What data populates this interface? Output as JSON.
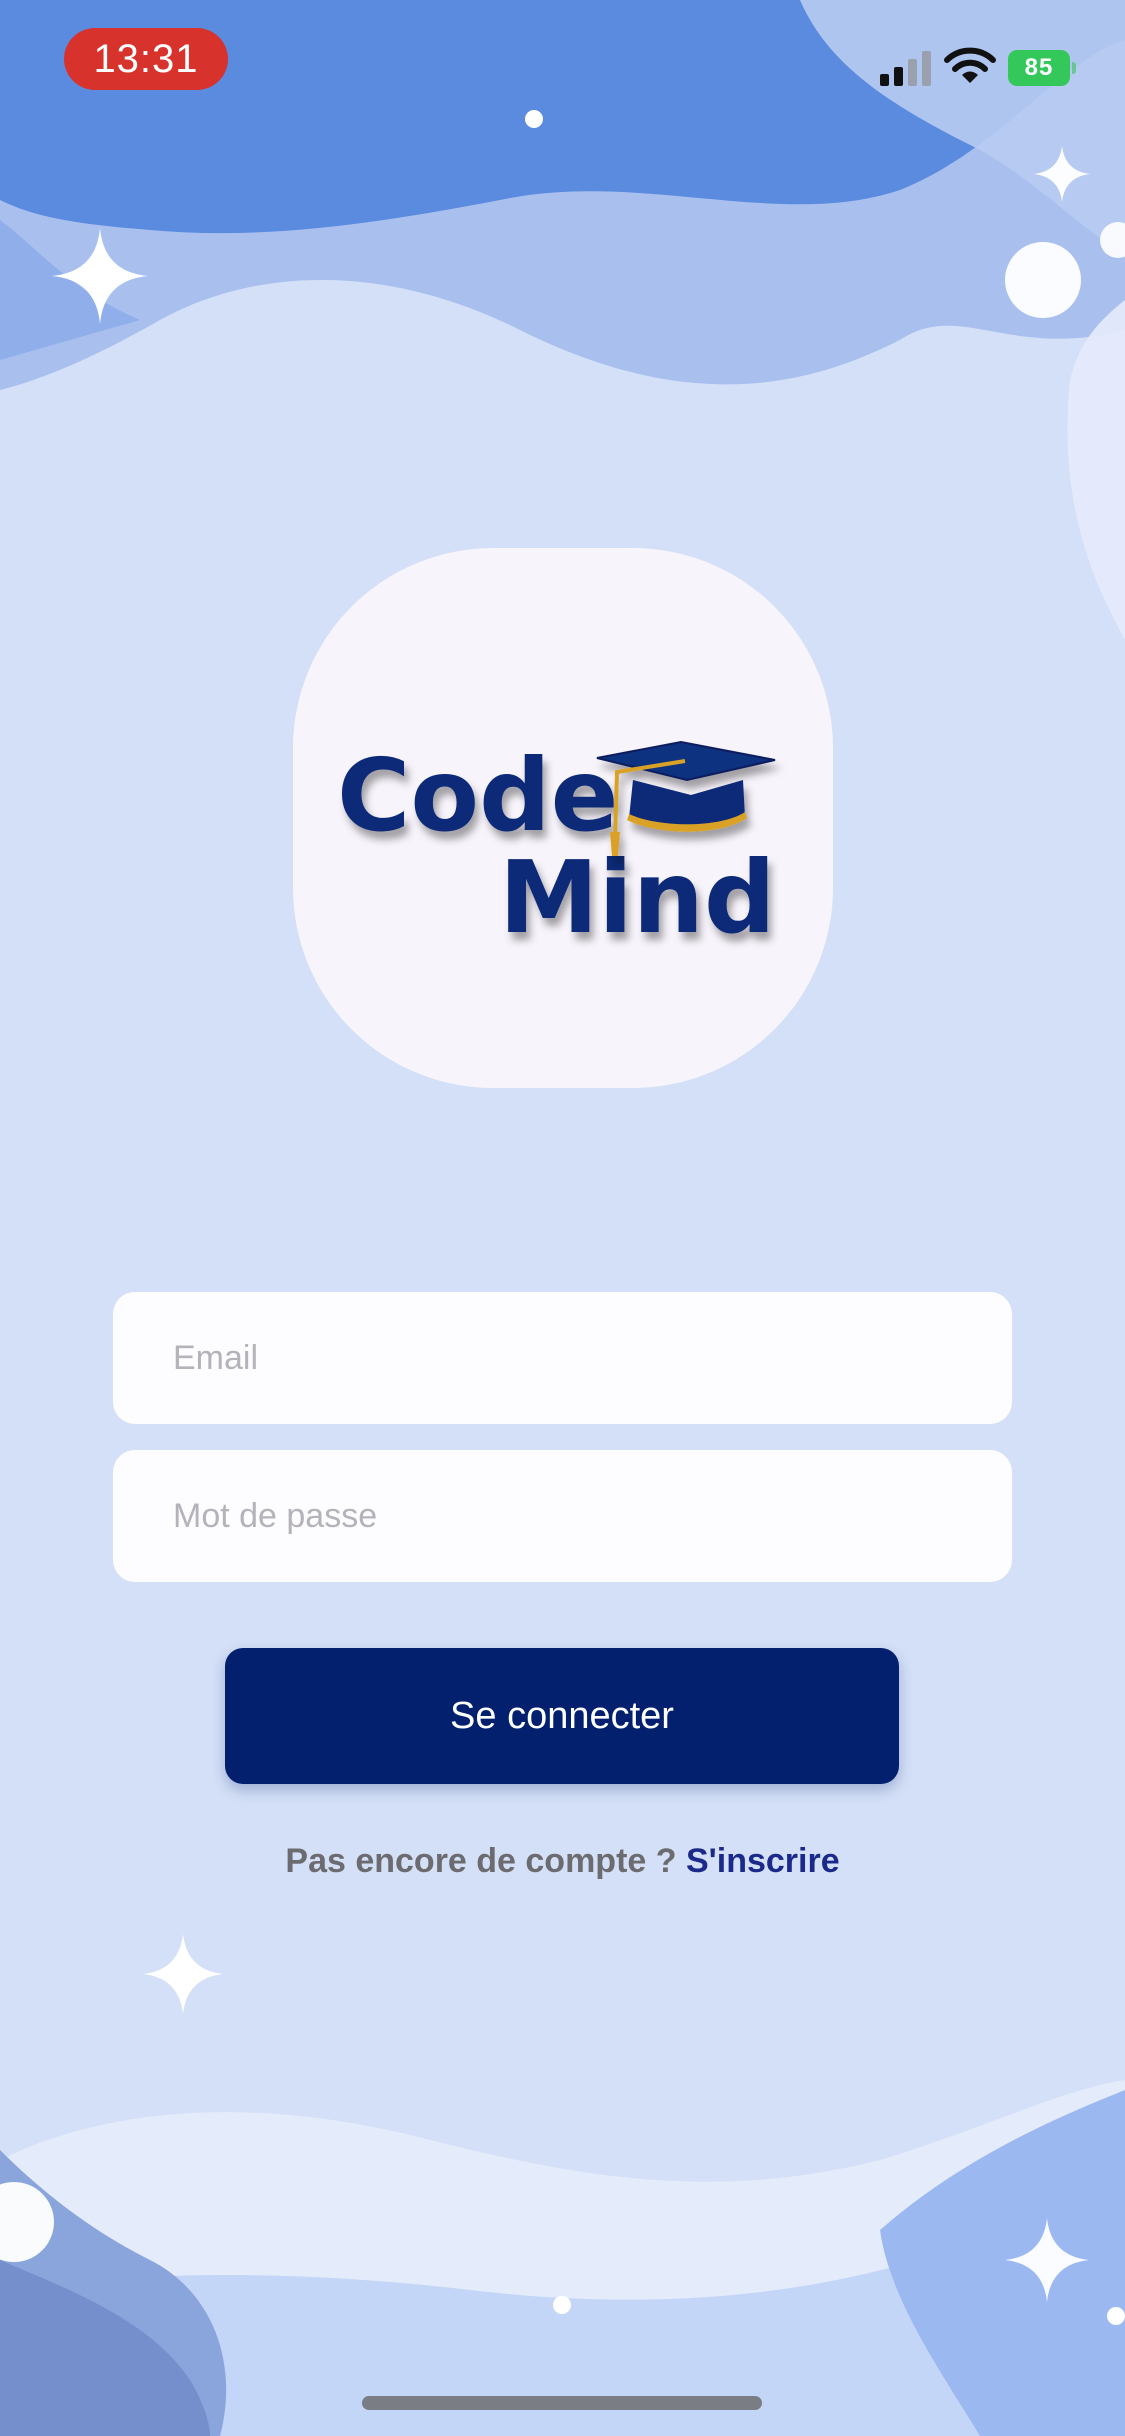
{
  "status_bar": {
    "time": "13:31",
    "battery_level": "85",
    "cellular_bars": 2,
    "icons": [
      "signal-icon",
      "wifi-icon",
      "battery-charging-icon"
    ]
  },
  "logo": {
    "line1": "Code",
    "line2": "Mind",
    "icon": "graduation-cap-icon"
  },
  "login_form": {
    "email_placeholder": "Email",
    "password_placeholder": "Mot de passe",
    "submit_label": "Se connecter"
  },
  "signup": {
    "prompt": "Pas encore de compte ?",
    "link_label": "S'inscrire"
  },
  "colors": {
    "primary": "#02206e",
    "link": "#1b2a8a",
    "background": "#d4e0f7",
    "wave_blue": "#5f8ee0",
    "status_pill": "#d7322b",
    "battery": "#34c759"
  }
}
